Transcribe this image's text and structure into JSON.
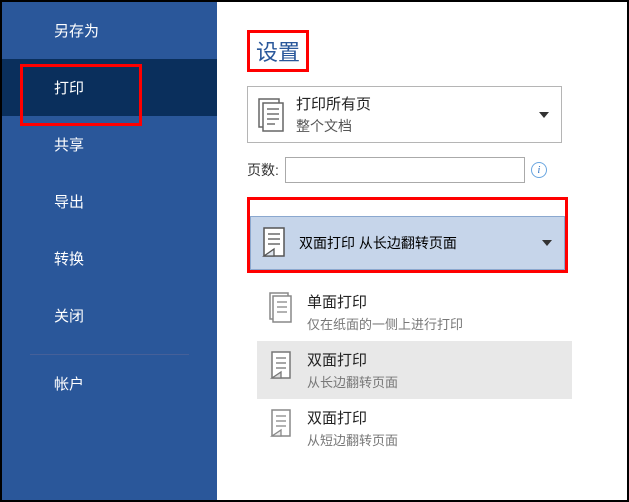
{
  "sidebar": {
    "items": [
      {
        "label": "另存为"
      },
      {
        "label": "打印"
      },
      {
        "label": "共享"
      },
      {
        "label": "导出"
      },
      {
        "label": "转换"
      },
      {
        "label": "关闭"
      },
      {
        "label": "帐户"
      }
    ]
  },
  "settings": {
    "heading": "设置",
    "print_scope": {
      "title": "打印所有页",
      "sub": "整个文档"
    },
    "pages_label": "页数:",
    "pages_value": "",
    "duplex_selected": {
      "title": "双面打印",
      "sub": "从长边翻转页面"
    },
    "options": [
      {
        "title": "单面打印",
        "sub": "仅在纸面的一侧上进行打印"
      },
      {
        "title": "双面打印",
        "sub": "从长边翻转页面"
      },
      {
        "title": "双面打印",
        "sub": "从短边翻转页面"
      }
    ]
  }
}
